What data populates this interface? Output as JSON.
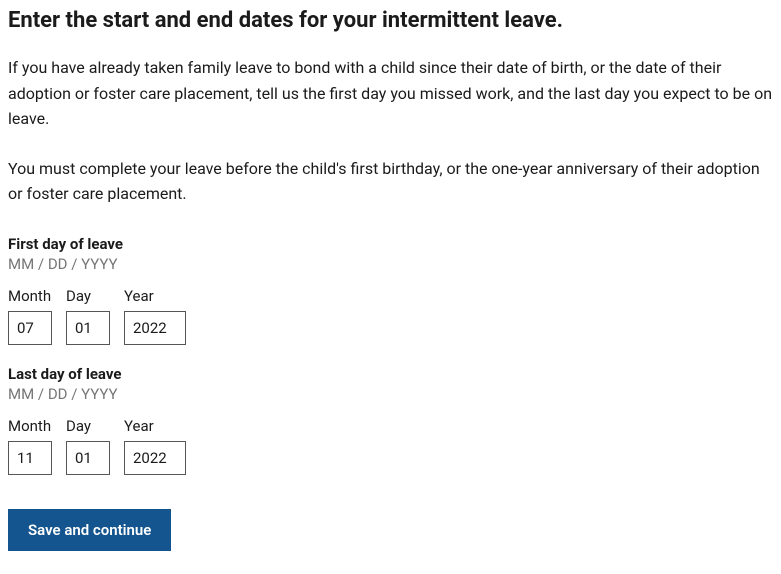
{
  "heading": "Enter the start and end dates for your intermittent leave.",
  "description": "If you have already taken family leave to bond with a child since their date of birth, or the date of their adoption or foster care placement, tell us the first day you missed work, and the last day you expect to be on leave.",
  "note": "You must complete your leave before the child's first birthday, or the one-year anniversary of their adoption or foster care placement.",
  "firstDay": {
    "legend": "First day of leave",
    "hint": "MM / DD / YYYY",
    "monthLabel": "Month",
    "dayLabel": "Day",
    "yearLabel": "Year",
    "month": "07",
    "day": "01",
    "year": "2022"
  },
  "lastDay": {
    "legend": "Last day of leave",
    "hint": "MM / DD / YYYY",
    "monthLabel": "Month",
    "dayLabel": "Day",
    "yearLabel": "Year",
    "month": "11",
    "day": "01",
    "year": "2022"
  },
  "buttonLabel": "Save and continue"
}
